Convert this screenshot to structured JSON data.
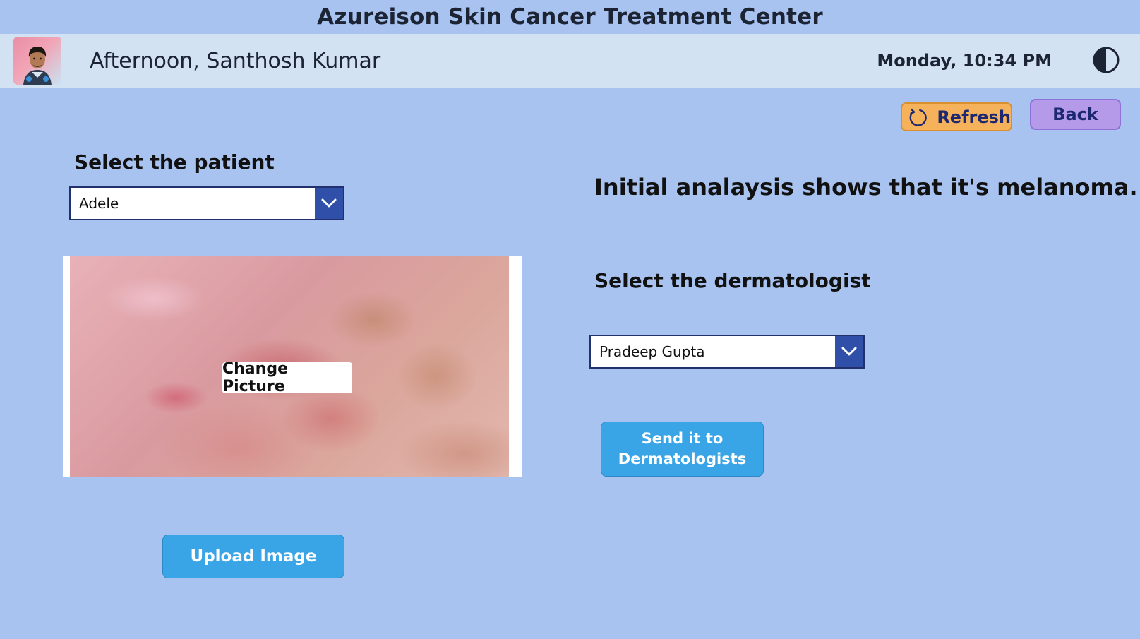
{
  "app": {
    "title": "Azureison Skin Cancer Treatment Center"
  },
  "header": {
    "greeting": "Afternoon, Santhosh Kumar",
    "datetime": "Monday, 10:34 PM",
    "avatar_icon": "user-avatar-photo",
    "theme_icon": "contrast-toggle-icon"
  },
  "toolbar": {
    "refresh_label": "Refresh",
    "refresh_icon": "refresh-icon",
    "back_label": "Back"
  },
  "patient": {
    "label": "Select the patient",
    "selected": "Adele"
  },
  "image": {
    "change_label": "Change Picture",
    "upload_label": "Upload Image"
  },
  "analysis": {
    "text": "Initial analaysis shows that it's melanoma."
  },
  "dermatologist": {
    "label": "Select the dermatologist",
    "selected": "Pradeep Gupta"
  },
  "send": {
    "line1": "Send it to",
    "line2": "Dermatologists"
  },
  "colors": {
    "background": "#a9c3f1",
    "header_bar": "#d3e2f3",
    "refresh_button": "#f6b15b",
    "back_button": "#b49ae8",
    "primary_button": "#3aa5e6",
    "dropdown_arrow": "#2f4fa8"
  }
}
